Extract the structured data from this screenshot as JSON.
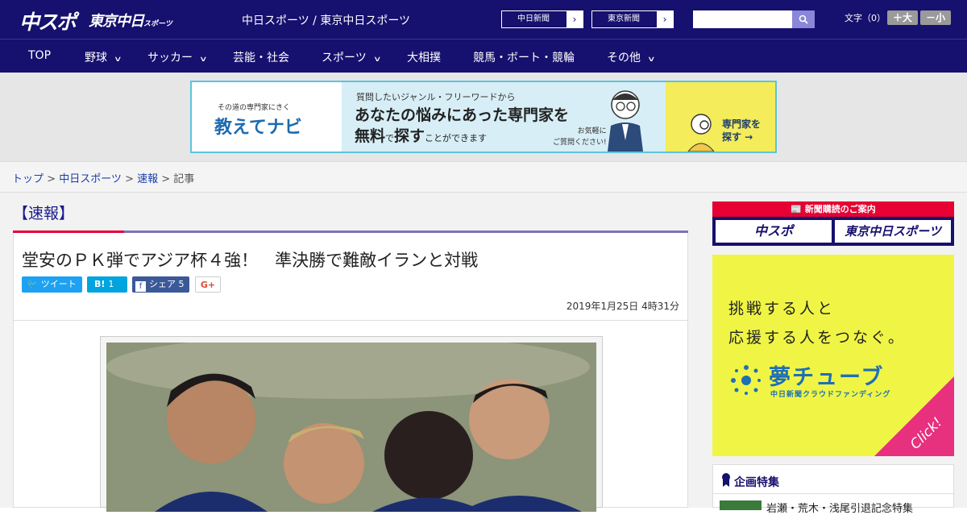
{
  "header": {
    "logo_chuspo": "中スポ",
    "logo_tokyo": "東京中日",
    "logo_tokyo_small": "スポーツ",
    "site_links": "中日スポーツ / 東京中日スポーツ",
    "newspaper_links": [
      "中日新聞",
      "東京新聞"
    ],
    "search": {
      "value": "",
      "placeholder": ""
    },
    "font_size_label": "文字（0）",
    "font_bigger": "＋大",
    "font_smaller": "－小"
  },
  "nav": {
    "items": [
      {
        "label": "TOP",
        "dropdown": false
      },
      {
        "label": "野球",
        "dropdown": true
      },
      {
        "label": "サッカー",
        "dropdown": true
      },
      {
        "label": "芸能・社会",
        "dropdown": false
      },
      {
        "label": "スポーツ",
        "dropdown": true
      },
      {
        "label": "大相撲",
        "dropdown": false
      },
      {
        "label": "競馬・ボート・競輪",
        "dropdown": false
      },
      {
        "label": "その他",
        "dropdown": true
      }
    ]
  },
  "ad_banner": {
    "tagline": "その道の専門家にきく",
    "brand": "教えてナビ",
    "line1": "質問したいジャンル・フリーワードから",
    "line2": "あなたの悩みにあった専門家を",
    "line3_a": "無料",
    "line3_b": "で",
    "line3_c": "探す",
    "line3_d": "ことができます",
    "note1": "お気軽に",
    "note2": "ご質問ください!",
    "cta1": "専門家を",
    "cta2": "探す →"
  },
  "breadcrumb": {
    "items": [
      "トップ",
      "中日スポーツ",
      "速報"
    ],
    "current": "記事",
    "separator": " > "
  },
  "article": {
    "category": "【速報】",
    "headline": "堂安のＰＫ弾でアジア杯４強！　準決勝で難敵イランと対戦",
    "share": {
      "tweet": "ツイート",
      "hatena_label": "B!",
      "hatena_count": "1",
      "facebook_label": "シェア",
      "facebook_count": "5",
      "gplus": "G+"
    },
    "date": "2019年1月25日 4時31分"
  },
  "sidebar": {
    "subscribe_title": "新聞購読のご案内",
    "subscribe_buttons": [
      "中スポ",
      "東京中日スポーツ"
    ],
    "yume_ad": {
      "line1": "挑戦する人と",
      "line2": "応援する人をつなぐ。",
      "brand": "夢チューブ",
      "sub": "中日新聞クラウドファンディング",
      "click": "Click!"
    },
    "feature": {
      "title": "企画特集",
      "item": "岩瀬・荒木・浅尾引退記念特集"
    }
  },
  "colors": {
    "header_bg": "#16106e",
    "accent_red": "#e60033",
    "link_blue": "#1a3ea8"
  }
}
